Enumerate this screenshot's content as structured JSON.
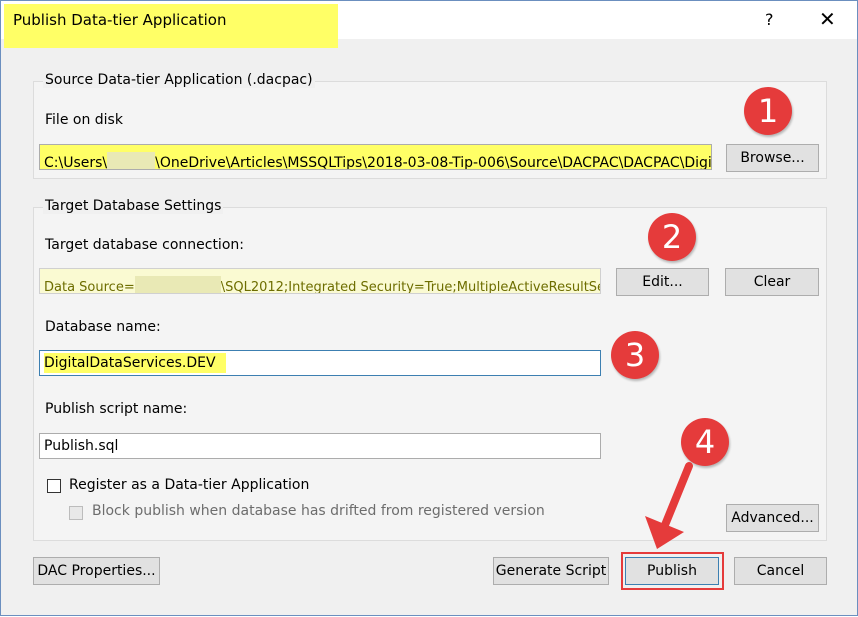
{
  "window": {
    "title": "Publish Data-tier Application",
    "help_icon": "?",
    "close_icon": "✕"
  },
  "source": {
    "group_title": "Source Data-tier Application (.dacpac)",
    "file_label": "File on disk",
    "file_value_prefix": "C:\\Users\\",
    "file_value_suffix": "\\OneDrive\\Articles\\MSSQLTips\\2018-03-08-Tip-006\\Source\\DACPAC\\DACPAC\\Digit",
    "browse_label": "Browse..."
  },
  "target": {
    "group_title": "Target Database Settings",
    "connection_label": "Target database connection:",
    "connection_prefix": "Data Source=",
    "connection_suffix": "\\SQL2012;Integrated Security=True;MultipleActiveResultSe",
    "edit_label": "Edit...",
    "clear_label": "Clear",
    "dbname_label": "Database name:",
    "dbname_value": "DigitalDataServices.DEV",
    "script_label": "Publish script name:",
    "script_value": "Publish.sql",
    "register_label": "Register as a Data-tier Application",
    "block_label": "Block publish when database has drifted from registered version",
    "advanced_label": "Advanced..."
  },
  "footer": {
    "dac_properties_label": "DAC Properties...",
    "generate_script_label": "Generate Script",
    "publish_label": "Publish",
    "cancel_label": "Cancel"
  },
  "annotations": {
    "step1": "1",
    "step2": "2",
    "step3": "3",
    "step4": "4"
  },
  "colors": {
    "highlight": "#ffff66",
    "annotation_red": "#e53b3b"
  }
}
